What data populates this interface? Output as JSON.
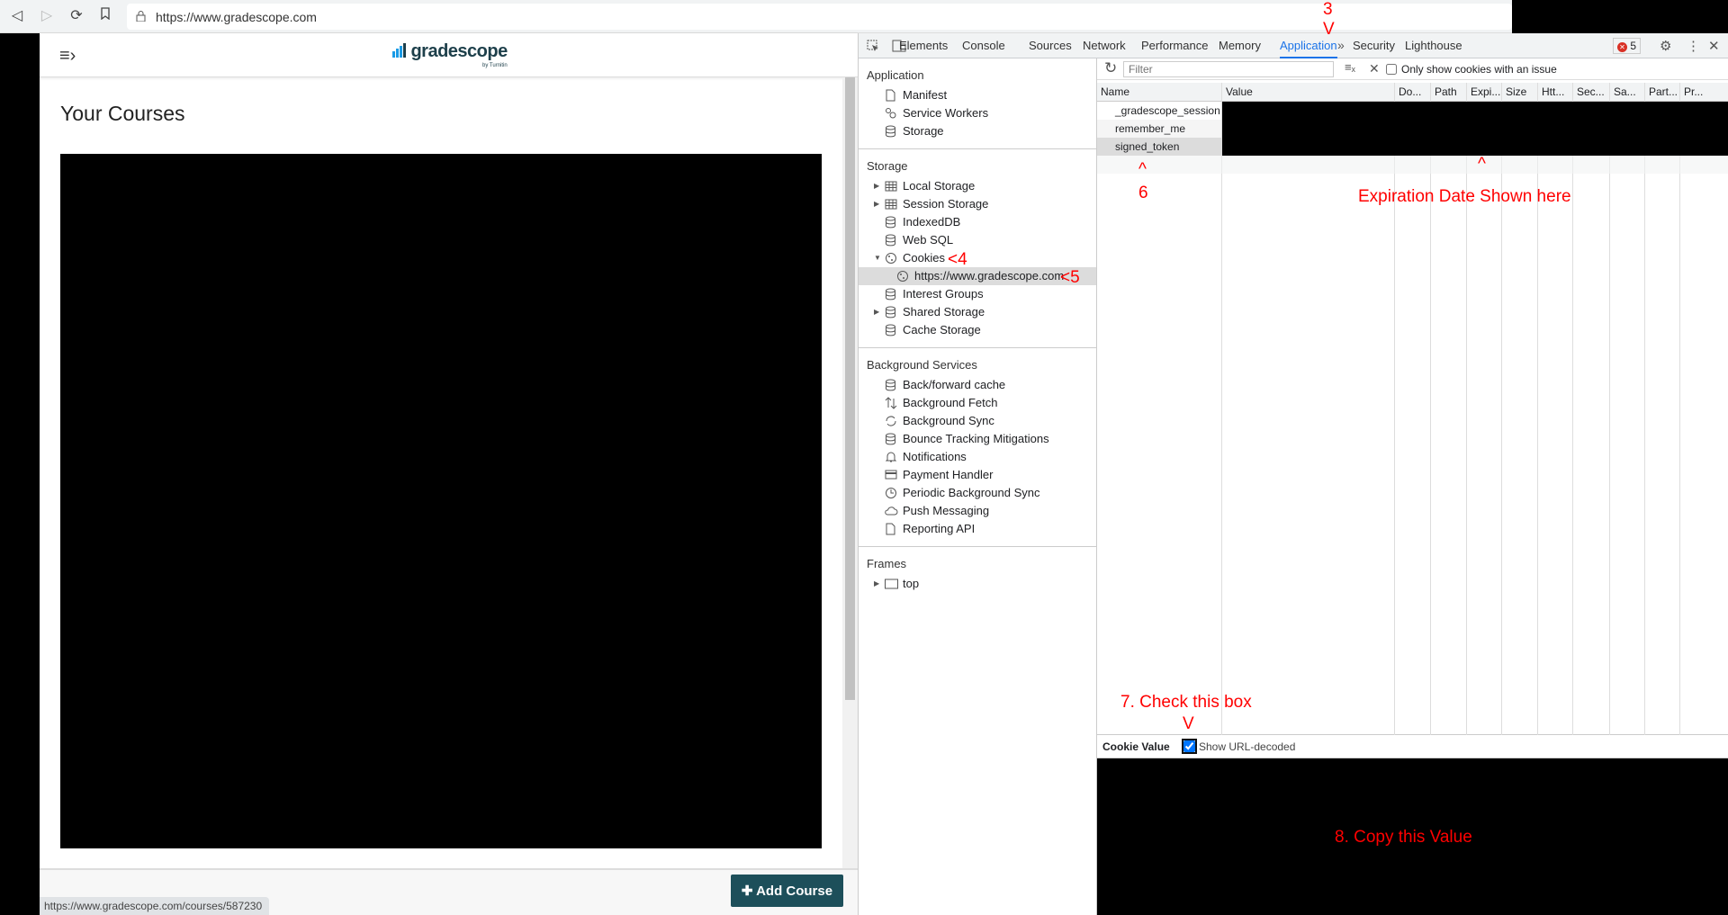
{
  "browser": {
    "url": "https://www.gradescope.com"
  },
  "page": {
    "logo_text": "gradescope",
    "logo_sub": "by Turnitin",
    "title": "Your Courses",
    "add_course": "Add Course",
    "status_url": "https://www.gradescope.com/courses/587230"
  },
  "devtools": {
    "tabs": [
      "Elements",
      "Console",
      "Sources",
      "Network",
      "Performance",
      "Memory",
      "Application",
      "Security",
      "Lighthouse"
    ],
    "active_tab": "Application",
    "error_count": "5",
    "sidebar": [
      {
        "header": "Application",
        "items": [
          {
            "label": "Manifest",
            "icon": "file"
          },
          {
            "label": "Service Workers",
            "icon": "gear"
          },
          {
            "label": "Storage",
            "icon": "db"
          }
        ]
      },
      {
        "header": "Storage",
        "items": [
          {
            "label": "Local Storage",
            "icon": "table",
            "expand": "right"
          },
          {
            "label": "Session Storage",
            "icon": "table",
            "expand": "right"
          },
          {
            "label": "IndexedDB",
            "icon": "db"
          },
          {
            "label": "Web SQL",
            "icon": "db"
          },
          {
            "label": "Cookies",
            "icon": "cookie",
            "expand": "down"
          },
          {
            "label": "https://www.gradescope.com",
            "icon": "cookie",
            "selected": true
          },
          {
            "label": "Interest Groups",
            "icon": "db"
          },
          {
            "label": "Shared Storage",
            "icon": "db",
            "expand": "right"
          },
          {
            "label": "Cache Storage",
            "icon": "db"
          }
        ]
      },
      {
        "header": "Background Services",
        "items": [
          {
            "label": "Back/forward cache",
            "icon": "db"
          },
          {
            "label": "Background Fetch",
            "icon": "arrows"
          },
          {
            "label": "Background Sync",
            "icon": "sync"
          },
          {
            "label": "Bounce Tracking Mitigations",
            "icon": "db"
          },
          {
            "label": "Notifications",
            "icon": "bell"
          },
          {
            "label": "Payment Handler",
            "icon": "card"
          },
          {
            "label": "Periodic Background Sync",
            "icon": "clock"
          },
          {
            "label": "Push Messaging",
            "icon": "cloud"
          },
          {
            "label": "Reporting API",
            "icon": "file"
          }
        ]
      },
      {
        "header": "Frames",
        "items": [
          {
            "label": "top",
            "icon": "frame",
            "expand": "right"
          }
        ]
      }
    ],
    "filter_placeholder": "Filter",
    "only_issues_label": "Only show cookies with an issue",
    "columns": [
      "Name",
      "Value",
      "Do...",
      "Path",
      "Expi...",
      "Size",
      "Htt...",
      "Sec...",
      "Sa...",
      "Part...",
      "Pr..."
    ],
    "cookies": [
      "_gradescope_session",
      "remember_me",
      "signed_token"
    ],
    "cookie_value_label": "Cookie Value",
    "url_decoded_label": "Show URL-decoded",
    "url_decoded_checked": true
  },
  "annotations": {
    "a3": "3",
    "a3v": "V",
    "a4": "<4",
    "a5": "<5",
    "a6c": "^",
    "a6": "6",
    "exp_caret": "^",
    "exp": "Expiration Date Shown here",
    "a7": "7. Check this box",
    "a7v": "V",
    "a8": "8. Copy this Value"
  }
}
